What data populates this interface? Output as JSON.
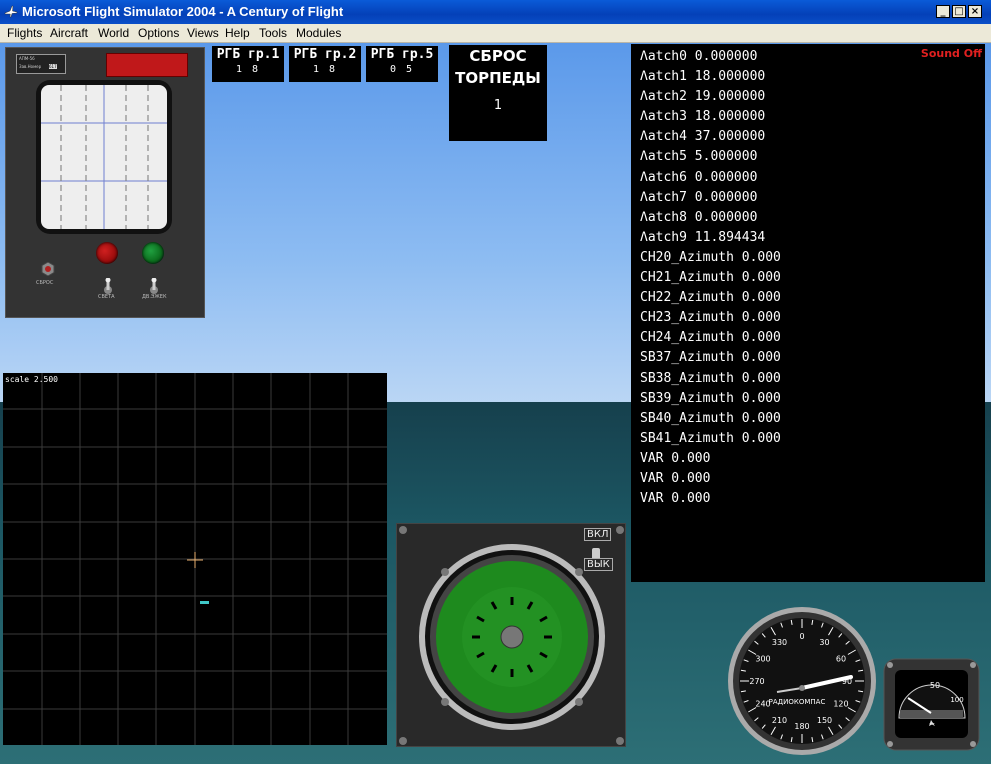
{
  "window": {
    "title": "Microsoft Flight Simulator 2004 - A Century of Flight"
  },
  "menu": [
    "Flights",
    "Aircraft",
    "World",
    "Options",
    "Views",
    "Help",
    "Tools",
    "Modules"
  ],
  "rgb_panels": [
    {
      "title": "РГБ гр.1",
      "value": "1  8"
    },
    {
      "title": "РГБ гр.2",
      "value": "1  8"
    },
    {
      "title": "РГБ гр.5",
      "value": "0  5"
    }
  ],
  "sbros": {
    "line1": "СБРОС",
    "line2": "ТОРПЕДЫ",
    "value": "1"
  },
  "panel1": {
    "badge_line1": "АПМ-56",
    "badge_line2": "Зав.Номер",
    "badge_num": "617",
    "label_sbros": "СБРОС",
    "label_sveta": "СВЕТА",
    "label_dvizh": "ДВ.ЭЖЕК",
    "colors": {
      "led": "#c0181a",
      "lamp_red": "#9a0c0c",
      "lamp_green": "#0b6b1c"
    }
  },
  "scale_panel": {
    "label": "scale 2.500",
    "cursor_color": "#e8b070",
    "blip_color": "#40c8c8"
  },
  "compass_panel": {
    "on_label": "ВКЛ",
    "off_label": "ВЫК",
    "dial_color": "#1e8a1e"
  },
  "readout": {
    "sound": "Sound Off",
    "lines": [
      "Λatch0 0.000000",
      "Λatch1 18.000000",
      "Λatch2 19.000000",
      "Λatch3 18.000000",
      "Λatch4 37.000000",
      "Λatch5 5.000000",
      "Λatch6 0.000000",
      "Λatch7 0.000000",
      "Λatch8 0.000000",
      "Λatch9 11.894434",
      "CH20_Azimuth 0.000",
      "CH21_Azimuth 0.000",
      "CH22_Azimuth 0.000",
      "CH23_Azimuth 0.000",
      "CH24_Azimuth 0.000",
      "SB37_Azimuth 0.000",
      "SB38_Azimuth 0.000",
      "SB39_Azimuth 0.000",
      "SB40_Azimuth 0.000",
      "SB41_Azimuth 0.000",
      "VAR 0.000",
      "VAR 0.000",
      "VAR 0.000"
    ]
  },
  "radiocompass": {
    "label": "РАДИОКОМПАС",
    "ticks": [
      "0",
      "30",
      "60",
      "90",
      "120",
      "150",
      "180",
      "210",
      "240",
      "270",
      "300",
      "330"
    ]
  },
  "small_gauge": {
    "label_50": "50",
    "label_100": "100"
  }
}
